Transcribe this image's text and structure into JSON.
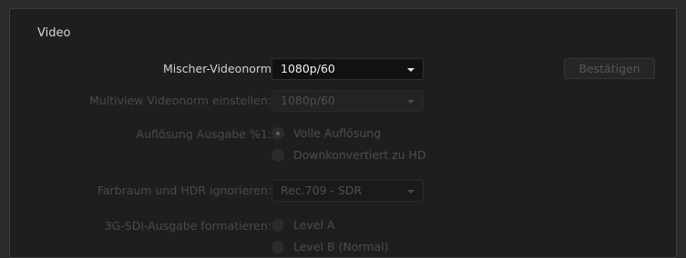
{
  "section_title": "Video",
  "mixer_videonorm": {
    "label": "Mischer-Videonorm",
    "value": "1080p/60"
  },
  "confirm_button": "Bestätigen",
  "multiview_norm": {
    "label": "Multiview Videonorm einstellen:",
    "value": "1080p/60"
  },
  "output_resolution": {
    "label": "Auflösung Ausgabe %1:",
    "options": [
      "Volle Auflösung",
      "Downkonvertiert zu HD"
    ],
    "selected": "Volle Auflösung"
  },
  "ignore_colorspace": {
    "label": "Farbraum und HDR ignorieren:",
    "value": "Rec.709 - SDR"
  },
  "sdi_format": {
    "label": "3G-SDI-Ausgabe formatieren:",
    "options": [
      "Level A",
      "Level B (Normal)"
    ]
  }
}
